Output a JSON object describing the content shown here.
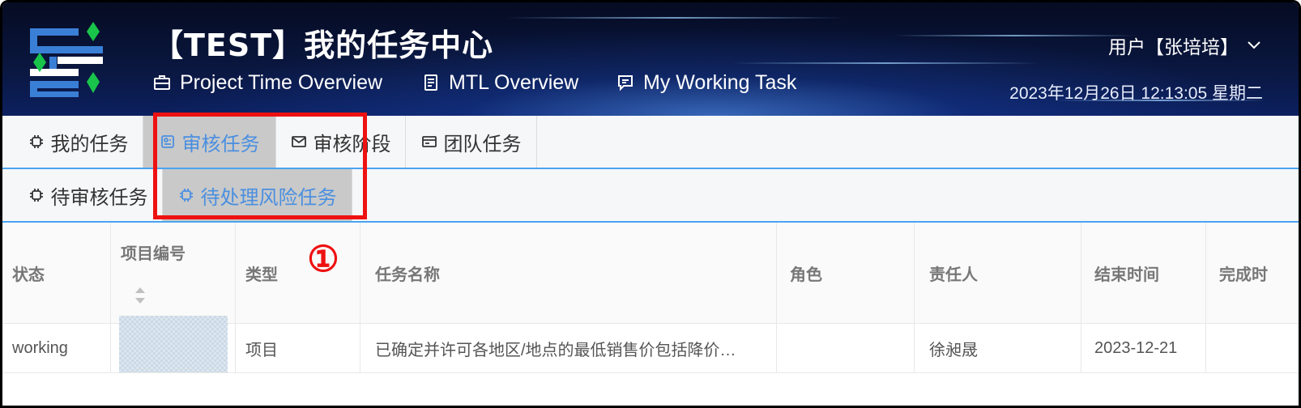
{
  "header": {
    "title": "【TEST】我的任务中心",
    "nav": [
      {
        "label": "Project Time Overview",
        "icon": "briefcase-icon"
      },
      {
        "label": "MTL Overview",
        "icon": "document-icon"
      },
      {
        "label": "My Working Task",
        "icon": "chat-icon"
      }
    ],
    "user_label": "用户【张培培】",
    "datetime": "2023年12月26日  12:13:05  星期二"
  },
  "tabs_primary": [
    {
      "label": "我的任务",
      "icon": "chip-icon",
      "active": false
    },
    {
      "label": "审核任务",
      "icon": "settings-card-icon",
      "active": true
    },
    {
      "label": "审核阶段",
      "icon": "mail-icon",
      "active": false
    },
    {
      "label": "团队任务",
      "icon": "card-icon",
      "active": false
    }
  ],
  "tabs_secondary": [
    {
      "label": "待审核任务",
      "icon": "chip-icon",
      "active": false
    },
    {
      "label": "待处理风险任务",
      "icon": "chip-icon",
      "active": true
    }
  ],
  "annotation": {
    "marker": "①",
    "color": "#ee1111"
  },
  "table": {
    "columns": [
      "状态",
      "项目编号",
      "类型",
      "任务名称",
      "角色",
      "责任人",
      "结束时间",
      "完成时"
    ],
    "rows": [
      [
        "working",
        "",
        "项目",
        "已确定并许可各地区/地点的最低销售价包括降价…",
        "",
        "徐昶晟",
        "2023-12-21",
        ""
      ]
    ]
  },
  "colors": {
    "accent": "#4a8fe0",
    "active_tab_bg": "#c9c9c9",
    "highlight": "#ee1111"
  }
}
